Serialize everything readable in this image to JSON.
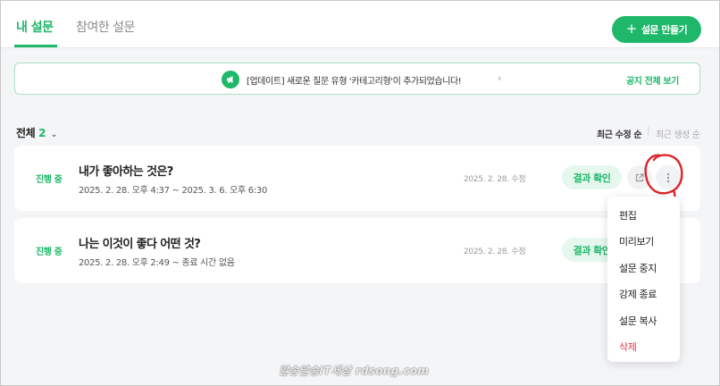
{
  "tabs": {
    "mine": "내 설문",
    "joined": "참여한 설문"
  },
  "create_button": {
    "label": "설문 만들기"
  },
  "notice": {
    "text": "[업데이트] 새로운 질문 유형 '카테고리형'이 추가되었습니다!",
    "link": "공지 전체 보기"
  },
  "filter": {
    "label": "전체",
    "count": "2"
  },
  "sort": {
    "recent_modified": "최근 수정 순",
    "separator": "|",
    "recent_created": "최근 생성 순"
  },
  "surveys": [
    {
      "status": "진행 중",
      "title": "내가 좋아하는 것은?",
      "period": "2025. 2. 28. 오후 4:37 ~ 2025. 3. 6. 오후 6:30",
      "modified": "2025. 2. 28. 수정",
      "result_label": "결과 확인"
    },
    {
      "status": "진행 중",
      "title": "나는 이것이 좋다 어떤 것?",
      "period": "2025. 2. 28. 오후 2:49 ~ 종료 시간 없음",
      "modified": "2025. 2. 28. 수정",
      "result_label": "결과 확인"
    }
  ],
  "more_menu": {
    "items": [
      "편집",
      "미리보기",
      "설문 중지",
      "강제 종료",
      "설문 복사",
      "삭제"
    ]
  },
  "watermark": "알송달송IT세상 rdsong.com",
  "colors": {
    "accent": "#1fb86a",
    "danger": "#e0394a",
    "annotation": "#d9252b"
  }
}
